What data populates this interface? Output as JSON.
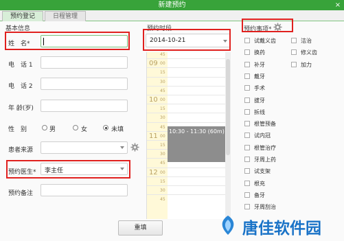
{
  "window": {
    "title": "新建预约",
    "close_label": "×"
  },
  "tabs": [
    {
      "label": "预约登记",
      "active": true
    },
    {
      "label": "日程管理",
      "active": false
    }
  ],
  "basic_info": {
    "section_title": "基本信息",
    "name_label": "姓　名*",
    "name_value": "",
    "phone1_label": "电　话 1",
    "phone2_label": "电　话 2",
    "age_label": "年 龄(岁)",
    "gender_label": "性　别",
    "gender_options": [
      "男",
      "女",
      "未填"
    ],
    "gender_selected": "未填",
    "source_label": "患者来源",
    "doctor_label": "预约医生*",
    "doctor_value": "李主任",
    "note_label": "预约备注"
  },
  "appointment_time": {
    "section_title": "预约时段",
    "date_value": "2014-10-21",
    "hours": [
      "09",
      "10",
      "11",
      "12"
    ],
    "minutes": [
      "00",
      "15",
      "30",
      "45"
    ],
    "first_row_minute": "45",
    "booked_label": "10:30 - 11:30 (60m)"
  },
  "items": {
    "section_title": "预约事项*",
    "col1": [
      "试戴义齿",
      "换药",
      "补牙",
      "戴牙",
      "手术",
      "拔牙",
      "拆线",
      "根管预备",
      "试内冠",
      "根管治疗",
      "牙周上药",
      "试支架",
      "根充",
      "备牙",
      "牙周刮治"
    ],
    "col2": [
      "洁治",
      "修义齿",
      "加力"
    ]
  },
  "footer": {
    "reset_label": "重填"
  },
  "watermark": {
    "text": "唐佳软件园",
    "color": "#1a73c7"
  }
}
